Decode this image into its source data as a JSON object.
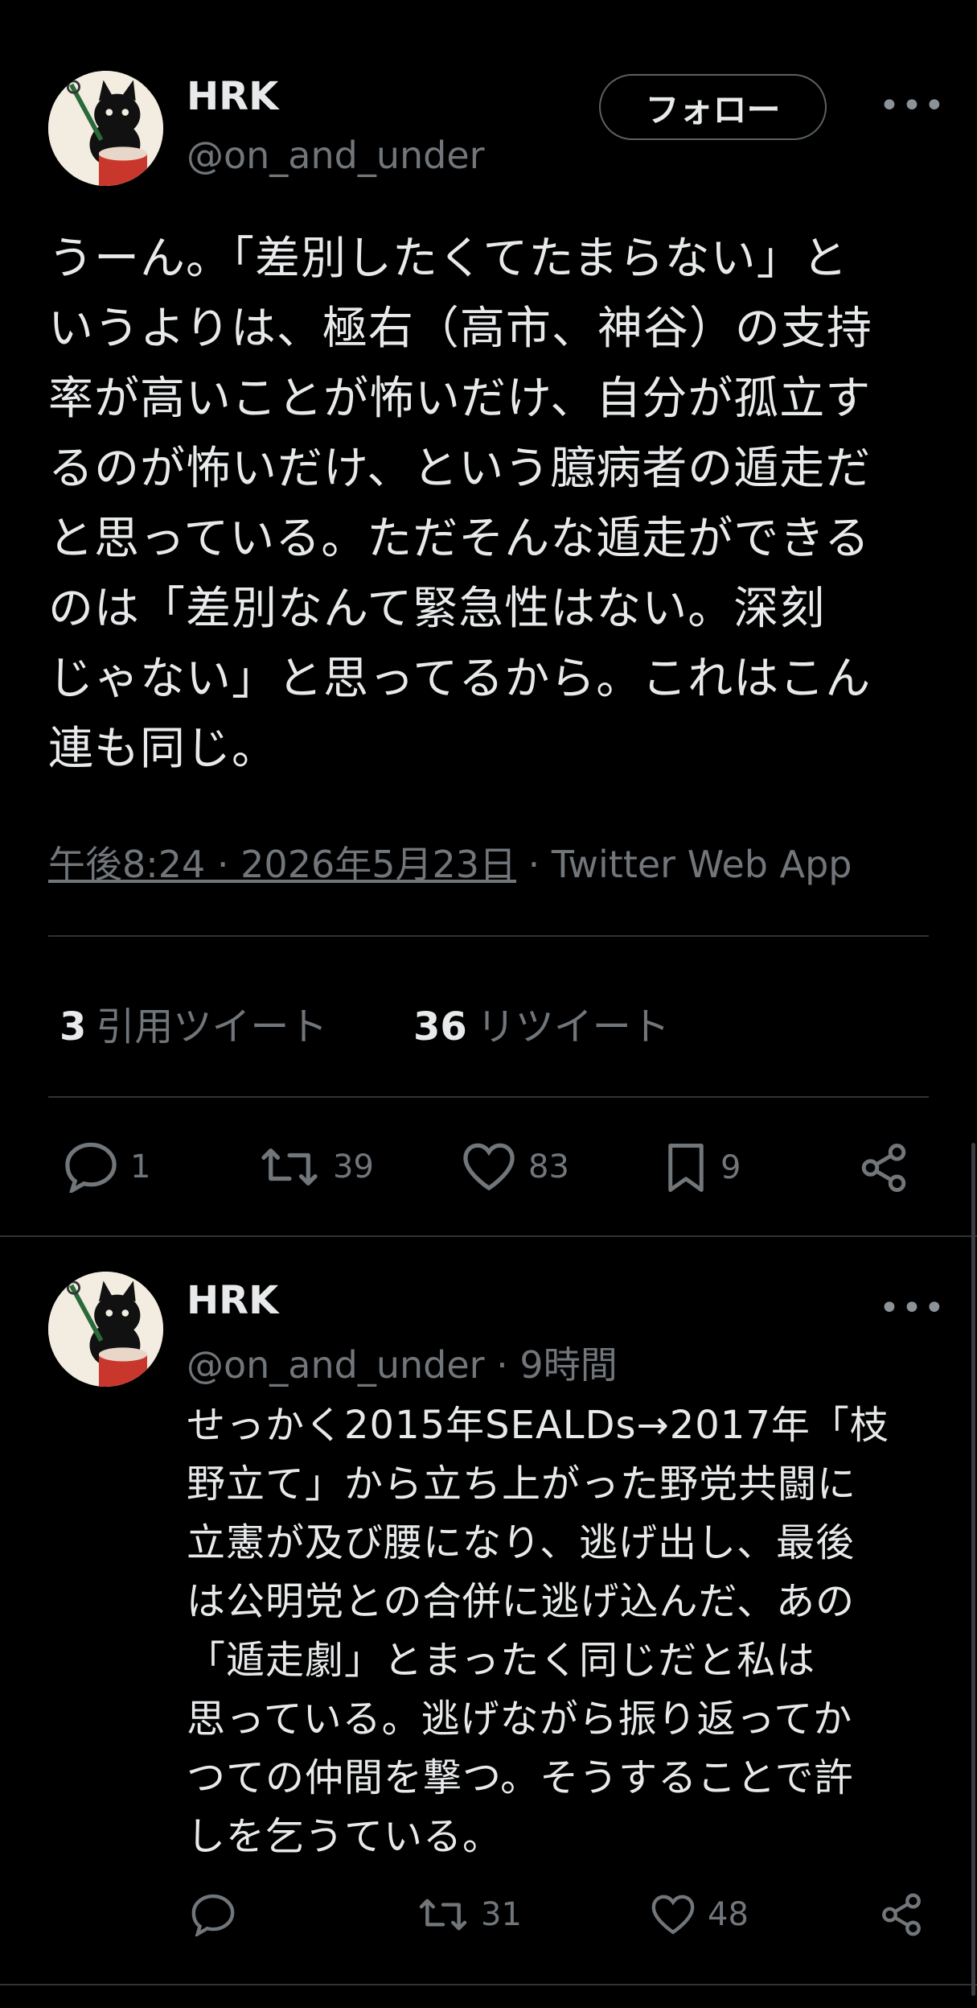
{
  "tweet": {
    "author_name": "HRK",
    "author_handle": "@on_and_under",
    "follow_label": "フォロー",
    "more_label": "•••",
    "text_lines": [
      "うーん。「差別したくてたまらない」と",
      "いうよりは、極右（高市、神谷）の支持",
      "率が高いことが怖いだけ、自分が孤立す",
      "るのが怖いだけ、という臆病者の遁走だ",
      "と思っている。ただそんな遁走ができる",
      "のは「差別なんて緊急性はない。深刻",
      "じゃない」と思ってるから。これはこん",
      "連も同じ。"
    ],
    "timestamp": "午後8:24 · 2026年5月23日",
    "source": " · Twitter Web App",
    "quote_count": "3",
    "quote_label": "引用ツイート",
    "retweet_count": "36",
    "retweet_label": "リツイート",
    "actions": {
      "reply": "1",
      "retweet": "39",
      "like": "83",
      "bookmark": "9"
    }
  },
  "reply": {
    "author_name": "HRK",
    "author_handle": "@on_and_under",
    "time": " · 9時間",
    "more_label": "•••",
    "text_lines": [
      "せっかく2015年SEALDs→2017年「枝",
      "野立て」から立ち上がった野党共闘に",
      "立憲が及び腰になり、逃げ出し、最後",
      "は公明党との合併に逃げ込んだ、あの",
      "「遁走劇」とまったく同じだと私は",
      "思っている。逃げながら振り返ってか",
      "つての仲間を撃つ。そうすることで許",
      "しを乞うている。"
    ],
    "actions": {
      "reply": "",
      "retweet": "31",
      "like": "48"
    }
  },
  "colors": {
    "background": "#000000",
    "text": "#e7e9ea",
    "muted": "#71767b",
    "divider": "#2f3336",
    "avatar_bg": "#f3ece1",
    "drum_red": "#c9372c"
  }
}
